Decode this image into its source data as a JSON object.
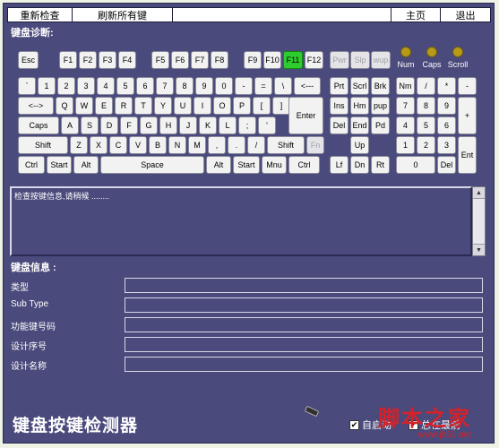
{
  "topbar": {
    "recheck": "重新检查",
    "refresh_all": "刷新所有键",
    "home": "主页",
    "exit": "退出"
  },
  "diag_title": "键盘诊断:",
  "leds": [
    "Num",
    "Caps",
    "Scroll"
  ],
  "keys": {
    "esc": "Esc",
    "f1": "F1",
    "f2": "F2",
    "f3": "F3",
    "f4": "F4",
    "f5": "F5",
    "f6": "F6",
    "f7": "F7",
    "f8": "F8",
    "f9": "F9",
    "f10": "F10",
    "f11": "F11",
    "f12": "F12",
    "pwr": "Pwr",
    "slp": "Slp",
    "wup": "wup",
    "row1": [
      "`",
      "1",
      "2",
      "3",
      "4",
      "5",
      "6",
      "7",
      "8",
      "9",
      "0",
      "-",
      "=",
      "\\",
      "<---"
    ],
    "row2": [
      "<-->",
      "Q",
      "W",
      "E",
      "R",
      "T",
      "Y",
      "U",
      "I",
      "O",
      "P",
      "[",
      "]"
    ],
    "enter": "Enter",
    "row3": [
      "Caps",
      "A",
      "S",
      "D",
      "F",
      "G",
      "H",
      "J",
      "K",
      "L",
      ";",
      "'"
    ],
    "row4": [
      "Shift",
      "Z",
      "X",
      "C",
      "V",
      "B",
      "N",
      "M",
      ",",
      ".",
      "/",
      "Shift",
      "Fn"
    ],
    "row5": [
      "Ctrl",
      "Start",
      "Alt",
      "Space",
      "Alt",
      "Start",
      "Mnu",
      "Ctrl"
    ],
    "nav1": [
      "Prt",
      "Scrl",
      "Brk"
    ],
    "nav2": [
      "Ins",
      "Hm",
      "pup"
    ],
    "nav3": [
      "Del",
      "End",
      "Pd"
    ],
    "up": "Up",
    "arrows": [
      "Lf",
      "Dn",
      "Rt"
    ],
    "num1": [
      "Nm",
      "/",
      "*",
      "-"
    ],
    "num2": [
      "7",
      "8",
      "9"
    ],
    "plus": "+",
    "num3": [
      "4",
      "5",
      "6"
    ],
    "num4": [
      "1",
      "2",
      "3"
    ],
    "num_enter": "Ent",
    "num5": [
      "0",
      "Del"
    ]
  },
  "active_key": "F11",
  "status_text": "检查按键信息,请稍候 ........",
  "info": {
    "title": "键盘信息 :",
    "rows": [
      "类型",
      "Sub Type",
      "功能键号码",
      "设计序号",
      "设计名称"
    ]
  },
  "app_title": "键盘按键检测器",
  "checkbox1": "自启动",
  "checkbox2": "总在最前",
  "watermark": "脚本之家",
  "watermark_url": "www.jb51.net",
  "colors": {
    "background": "#4a4a7c",
    "key": "#f2f2f2",
    "active_key": "#2ecc2e",
    "led": "#b69a18",
    "watermark": "#d2232a"
  }
}
